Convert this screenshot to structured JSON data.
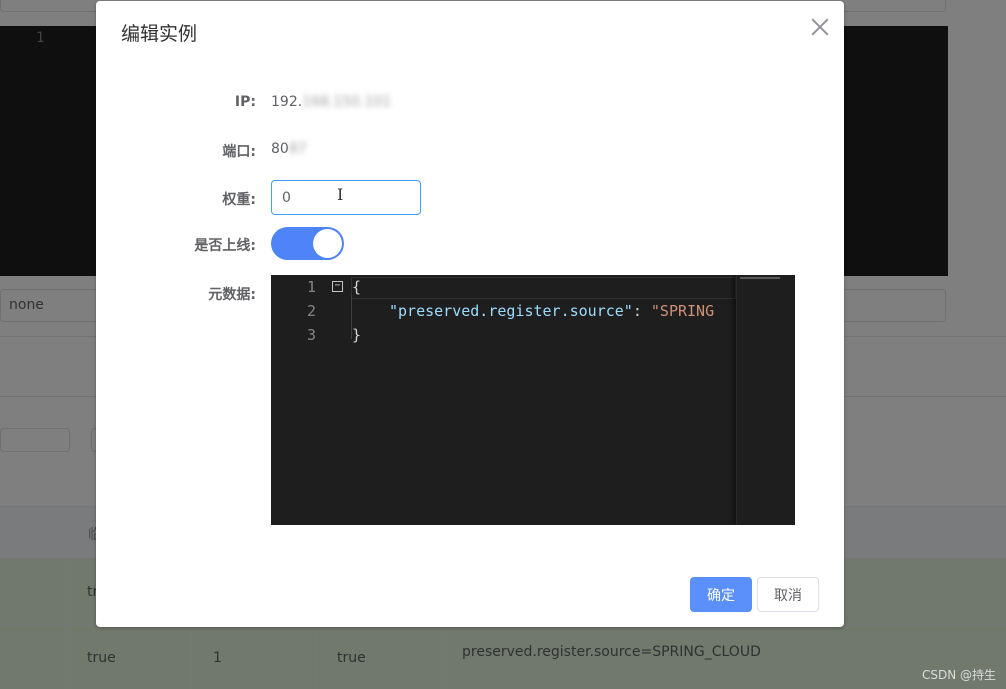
{
  "background": {
    "editor_line": "1",
    "select_value": "none",
    "table_header_fragment": "临",
    "row1": {
      "col2": "tr"
    },
    "row2": {
      "col2": "true",
      "col3": "1",
      "col4": "true",
      "metadata": "preserved.register.source=SPRING_CLOUD"
    }
  },
  "dialog": {
    "title": "编辑实例",
    "close_icon": "close-icon",
    "ip_label": "IP:",
    "ip_prefix": "192.",
    "ip_blurred": "168.150.101",
    "port_label": "端口:",
    "port_prefix": "80",
    "port_blurred": "87",
    "weight_label": "权重:",
    "weight_value": "0",
    "online_label": "是否上线:",
    "online_enabled": true,
    "metadata_label": "元数据:",
    "editor": {
      "line_numbers": [
        "1",
        "2",
        "3"
      ],
      "open_brace": "{",
      "key": "\"preserved.register.source\"",
      "colon": ": ",
      "value_fragment": "\"SPRING",
      "close_brace": "}",
      "fold_icon": "fold-collapse-icon"
    },
    "confirm_label": "确定",
    "cancel_label": "取消"
  },
  "watermark": "CSDN @持生",
  "colors": {
    "primary": "#5b8ff9",
    "switch_on": "#4e84f7",
    "editor_bg": "#1e1e1e",
    "row_success": "#e1f3d8"
  }
}
